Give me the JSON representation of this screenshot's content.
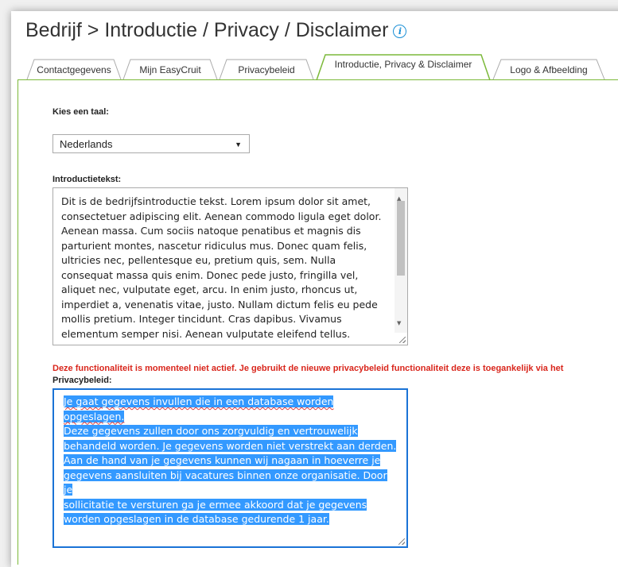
{
  "header": {
    "title": "Bedrijf > Introductie / Privacy / Disclaimer",
    "info_icon": "info-icon"
  },
  "tabs": [
    {
      "label": "Contactgegevens"
    },
    {
      "label": "Mijn EasyCruit"
    },
    {
      "label": "Privacybeleid"
    },
    {
      "label": "Introductie, Privacy & Disclaimer",
      "active": true
    },
    {
      "label": "Logo & Afbeelding"
    }
  ],
  "language": {
    "label": "Kies een taal:",
    "selected": "Nederlands"
  },
  "introduction": {
    "label": "Introductietekst:",
    "lines": [
      "Dit is de bedrijfsintroductie tekst. Lorem ipsum dolor sit amet,",
      "consectetuer adipiscing elit. Aenean commodo ligula eget dolor.",
      "Aenean massa. Cum sociis natoque penatibus et magnis dis",
      "parturient montes, nascetur ridiculus mus. Donec quam felis,",
      "ultricies nec, pellentesque eu, pretium quis, sem. Nulla",
      "consequat massa quis enim. Donec pede justo, fringilla vel,",
      "aliquet nec, vulputate eget, arcu. In enim justo, rhoncus ut,",
      "imperdiet a, venenatis vitae, justo. Nullam dictum felis eu pede",
      "mollis pretium. Integer tincidunt. Cras dapibus. Vivamus",
      "elementum semper nisi. Aenean vulputate eleifend tellus."
    ]
  },
  "warning": "Deze functionaliteit is momenteel niet actief. Je gebruikt de nieuwe privacybeleid functionaliteit deze is toegankelijk via het",
  "privacy": {
    "label": "Privacybeleid:",
    "lines": [
      "Je gaat gegevens invullen die in een database worden opgeslagen.",
      "Deze gegevens zullen door ons zorgvuldig en vertrouwelijk",
      "behandeld worden. Je gegevens worden niet verstrekt aan derden.",
      "Aan de hand van je gegevens kunnen wij nagaan in hoeverre je",
      "gegevens aansluiten bij vacatures binnen onze organisatie. Door je",
      "sollicitatie te versturen ga je ermee akkoord dat je gegevens",
      "worden opgeslagen in de database gedurende 1 jaar."
    ]
  },
  "colors": {
    "accent_green": "#7cb93a",
    "warning_red": "#d9261c",
    "selection_blue": "#3399ff",
    "info_blue": "#1a8fd6"
  }
}
